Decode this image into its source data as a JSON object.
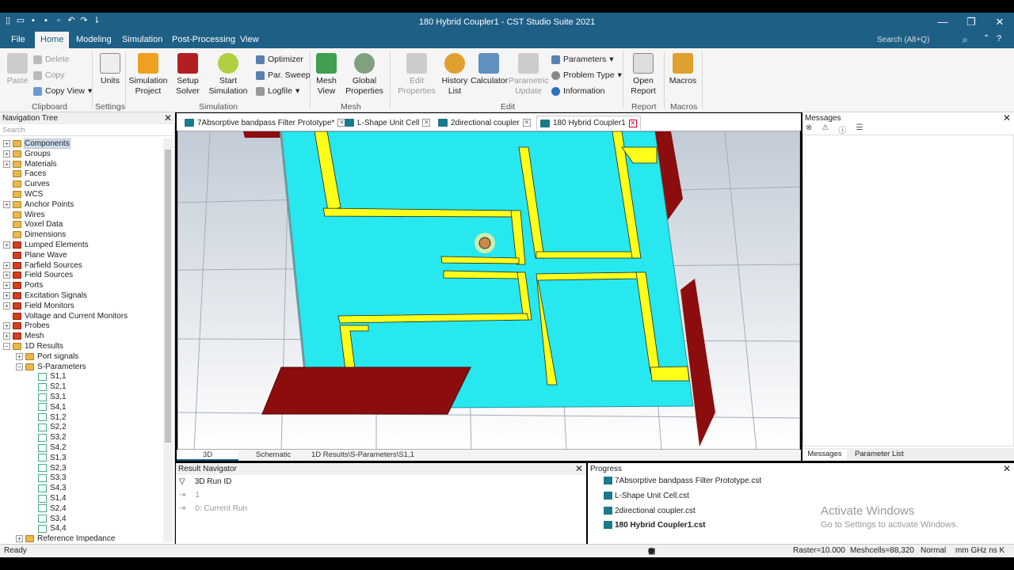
{
  "window": {
    "title": "180 Hybrid Coupler1 - CST Studio Suite 2021",
    "min": "—",
    "max": "❐",
    "close": "✕"
  },
  "menu": {
    "file": "File",
    "home": "Home",
    "modeling": "Modeling",
    "simulation": "Simulation",
    "post": "Post-Processing",
    "view": "View",
    "search": "Search (Alt+Q)"
  },
  "ribbon": {
    "paste": "Paste",
    "delete": "Delete",
    "copy": "Copy",
    "copy_view": "Copy View",
    "clipboard": "Clipboard",
    "units": "Units",
    "settings": "Settings",
    "sim_project": "Simulation\nProject",
    "setup_solver": "Setup\nSolver",
    "start_sim": "Start\nSimulation",
    "optimizer": "Optimizer",
    "par_sweep": "Par. Sweep",
    "logfile": "Logfile",
    "simulation": "Simulation",
    "mesh_view": "Mesh\nView",
    "global_props": "Global\nProperties",
    "mesh": "Mesh",
    "edit_props": "Edit\nProperties",
    "history": "History\nList",
    "calculator": "Calculator",
    "param_update": "Parametric\nUpdate",
    "parameters": "Parameters",
    "problem_type": "Problem Type",
    "information": "Information",
    "edit": "Edit",
    "open_report": "Open\nReport",
    "report": "Report",
    "macros_btn": "Macros",
    "macros": "Macros"
  },
  "nav": {
    "title": "Navigation Tree",
    "search": "Search",
    "items": [
      "Components",
      "Groups",
      "Materials",
      "Faces",
      "Curves",
      "WCS",
      "Anchor Points",
      "Wires",
      "Voxel Data",
      "Dimensions",
      "Lumped Elements",
      "Plane Wave",
      "Farfield Sources",
      "Field Sources",
      "Ports",
      "Excitation Signals",
      "Field Monitors",
      "Voltage and Current Monitors",
      "Probes",
      "Mesh",
      "1D Results",
      "Port signals",
      "S-Parameters",
      "S1,1",
      "S2,1",
      "S3,1",
      "S4,1",
      "S1,2",
      "S2,2",
      "S3,2",
      "S4,2",
      "S1,3",
      "S2,3",
      "S3,3",
      "S4,3",
      "S1,4",
      "S2,4",
      "S3,4",
      "S4,4",
      "Reference Impedance"
    ]
  },
  "tabs": [
    "7Absorptive bandpass Filter Prototype*",
    "L-Shape Unit Cell",
    "2directional coupler",
    "180 Hybrid Coupler1"
  ],
  "view_tabs": [
    "3D",
    "Schematic",
    "1D Results\\S-Parameters\\S1,1"
  ],
  "messages": {
    "title": "Messages",
    "tab1": "Messages",
    "tab2": "Parameter List"
  },
  "result_nav": {
    "title": "Result Navigator",
    "col": "3D Run ID",
    "r1": "1",
    "r2": "0: Current Run"
  },
  "progress": {
    "title": "Progress",
    "items": [
      "7Absorptive bandpass Filter Prototype.cst",
      "L-Shape Unit Cell.cst",
      "2directional coupler.cst",
      "180 Hybrid Coupler1.cst"
    ]
  },
  "watermark": {
    "line1": "Activate Windows",
    "line2": "Go to Settings to activate Windows."
  },
  "status": {
    "ready": "Ready",
    "raster": "Raster=10.000",
    "meshcells": "Meshcells=88,320",
    "normal": "Normal",
    "units": "mm  GHz  ns  K"
  },
  "colors": {
    "substrate": "#27e8ee",
    "trace": "#ffff1a",
    "port": "#8b0d0d",
    "titlebar": "#1e5f86"
  }
}
